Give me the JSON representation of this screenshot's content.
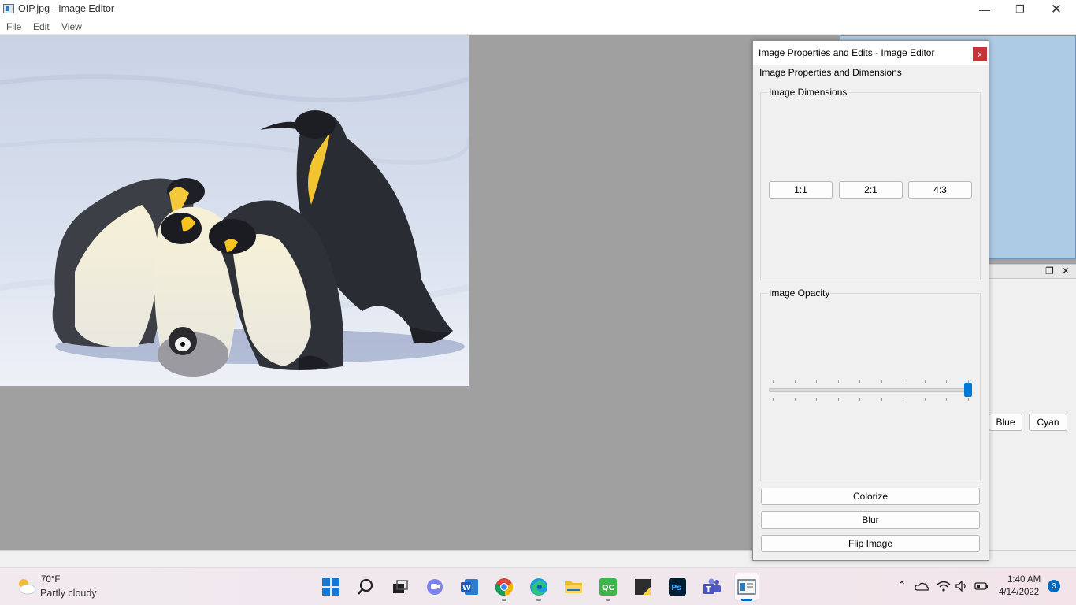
{
  "window": {
    "title": "OIP.jpg - Image Editor"
  },
  "menu": {
    "items": [
      "File",
      "Edit",
      "View"
    ]
  },
  "canvas": {
    "image_description": "Emperor penguins on snow",
    "background": "#a0a0a0"
  },
  "dock": {
    "buttons": [
      "Blue",
      "Cyan"
    ],
    "accent": "#aecbe6"
  },
  "dialog": {
    "title": "Image Properties and Edits - Image Editor",
    "close_label": "x",
    "tab_label": "Image Properties and Dimensions",
    "dimensions": {
      "title": "Image Dimensions",
      "ratio_buttons": [
        "1:1",
        "2:1",
        "4:3"
      ]
    },
    "opacity": {
      "title": "Image Opacity",
      "value": 1.0,
      "tick_count": 10,
      "accent": "#0078d7"
    },
    "actions": [
      "Colorize",
      "Blur",
      "Flip Image"
    ]
  },
  "taskbar": {
    "weather": {
      "temp": "70°F",
      "desc": "Partly cloudy"
    },
    "apps": [
      "start-icon",
      "search-icon",
      "task-view-icon",
      "teams-chat-icon",
      "word-icon",
      "chrome-icon",
      "edge-icon",
      "file-explorer-icon",
      "qc-app-icon",
      "sticky-notes-icon",
      "photoshop-icon",
      "teams-icon",
      "image-editor-icon"
    ],
    "clock": {
      "time": "1:40 AM",
      "date": "4/14/2022"
    },
    "notifications": "3"
  }
}
